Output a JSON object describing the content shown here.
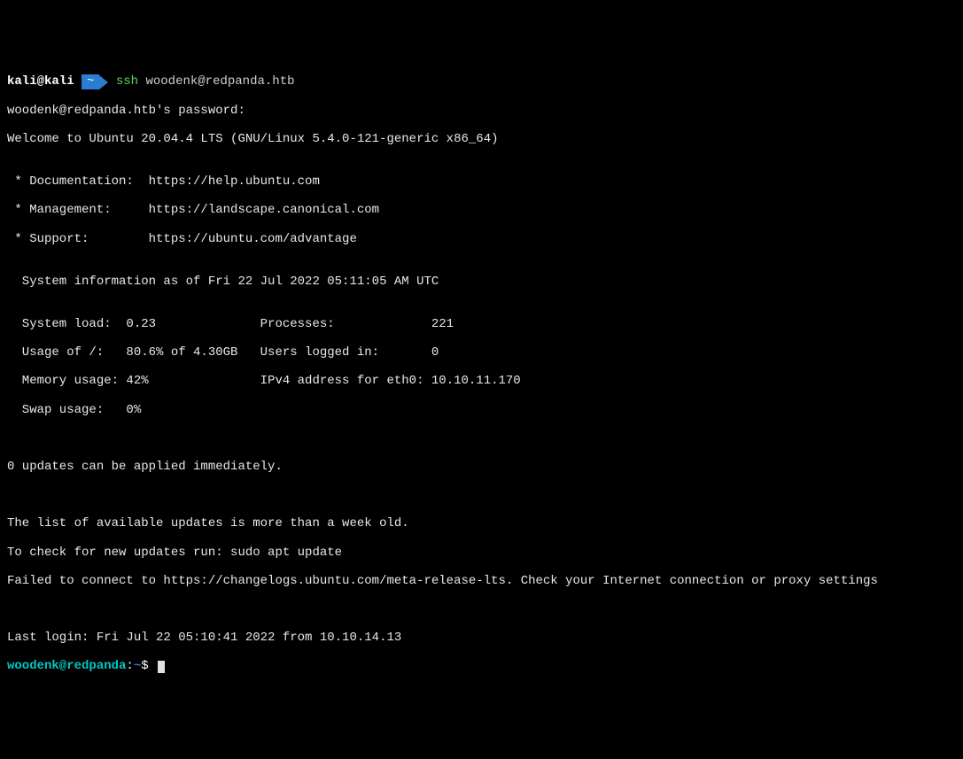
{
  "prompt1": {
    "user_host": "kali@kali",
    "path": "~",
    "command_name": "ssh",
    "command_arg": "woodenk@redpanda.htb"
  },
  "motd": {
    "password_prompt": "woodenk@redpanda.htb's password:",
    "welcome": "Welcome to Ubuntu 20.04.4 LTS (GNU/Linux 5.4.0-121-generic x86_64)",
    "blank1": "",
    "doc_line": " * Documentation:  https://help.ubuntu.com",
    "mgmt_line": " * Management:     https://landscape.canonical.com",
    "support_line": " * Support:        https://ubuntu.com/advantage",
    "blank2": "",
    "sysinfo_header": "  System information as of Fri 22 Jul 2022 05:11:05 AM UTC",
    "blank3": "",
    "row1": "  System load:  0.23              Processes:             221",
    "row2": "  Usage of /:   80.6% of 4.30GB   Users logged in:       0",
    "row3": "  Memory usage: 42%               IPv4 address for eth0: 10.10.11.170",
    "row4": "  Swap usage:   0%",
    "blank4": "",
    "blank5": "",
    "updates": "0 updates can be applied immediately.",
    "blank6": "",
    "blank7": "",
    "list_old": "The list of available updates is more than a week old.",
    "check_new": "To check for new updates run: sudo apt update",
    "fail_connect": "Failed to connect to https://changelogs.ubuntu.com/meta-release-lts. Check your Internet connection or proxy settings",
    "blank8": "",
    "blank9": "",
    "last_login": "Last login: Fri Jul 22 05:10:41 2022 from 10.10.14.13"
  },
  "prompt2": {
    "user_host": "woodenk@redpanda",
    "colon": ":",
    "path": "~",
    "dollar": "$"
  }
}
